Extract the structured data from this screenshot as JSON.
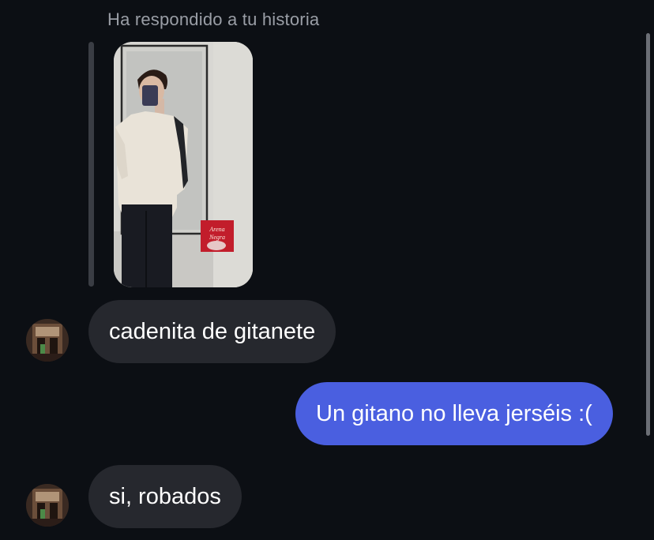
{
  "story_reply": {
    "label": "Ha respondido a tu historia",
    "story_image_icon": "story-photo",
    "sticker_text_line1": "Arena",
    "sticker_text_line2": "Negra"
  },
  "messages": [
    {
      "sender": "other",
      "text": "cadenita de gitanete"
    },
    {
      "sender": "me",
      "text": "Un gitano no lleva jerséis :("
    },
    {
      "sender": "other",
      "text": "si, robados"
    }
  ],
  "colors": {
    "background": "#0c0f14",
    "incoming_bubble": "#26282e",
    "outgoing_bubble": "#4a5fe0",
    "meta_text": "#9a9ea6"
  }
}
